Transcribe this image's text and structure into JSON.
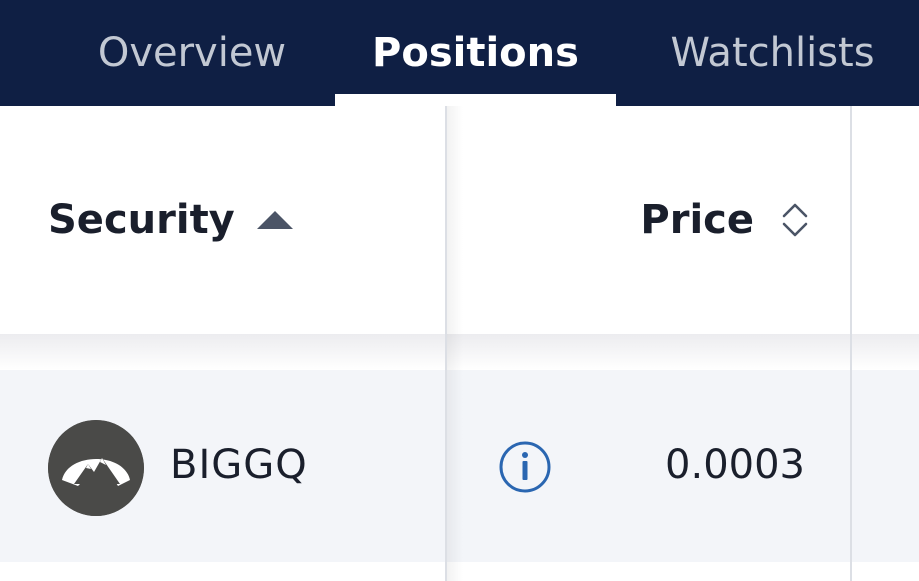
{
  "nav": {
    "tabs": [
      {
        "label": "Overview",
        "active": false
      },
      {
        "label": "Positions",
        "active": true
      },
      {
        "label": "Watchlists",
        "active": false
      }
    ],
    "background_color": "#0f1f44",
    "active_underline_color": "#ffffff"
  },
  "table": {
    "columns": [
      {
        "label": "Security",
        "sort": "ascending",
        "sort_icon": "sort-ascending-icon"
      },
      {
        "label": "Price",
        "sort": "none",
        "sort_icon": "sort-both-icon"
      }
    ],
    "rows": [
      {
        "logo_icon": "mountain-logo-icon",
        "symbol": "BIGGQ",
        "info_icon": "info-icon",
        "price": "0.0003"
      }
    ],
    "row_background_color": "#f3f5f9",
    "info_icon_color": "#2a66b1"
  }
}
